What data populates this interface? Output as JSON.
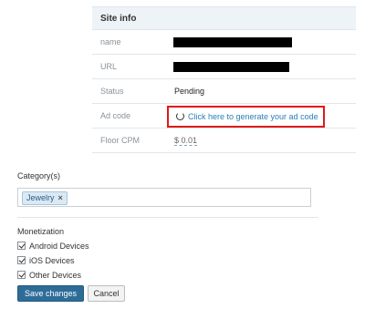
{
  "site_info": {
    "title": "Site info",
    "rows": {
      "name": {
        "label": "name"
      },
      "url": {
        "label": "URL"
      },
      "status": {
        "label": "Status",
        "value": "Pending"
      },
      "ad_code": {
        "label": "Ad code",
        "link": "Click here to generate your ad code",
        "icon": "refresh-icon"
      },
      "floor_cpm": {
        "label": "Floor CPM",
        "value": "$ 0.01"
      }
    }
  },
  "category": {
    "label": "Category(s)",
    "chips": [
      {
        "label": "Jewelry",
        "remove_glyph": "×"
      }
    ]
  },
  "monetization": {
    "label": "Monetization",
    "options": [
      {
        "label": "Android Devices",
        "checked": true
      },
      {
        "label": "iOS Devices",
        "checked": true
      },
      {
        "label": "Other Devices",
        "checked": true
      }
    ]
  },
  "buttons": {
    "save": "Save changes",
    "cancel": "Cancel"
  },
  "colors": {
    "highlight_box": "#e11919",
    "link": "#2a7fb8",
    "primary_button": "#2e6c98"
  }
}
